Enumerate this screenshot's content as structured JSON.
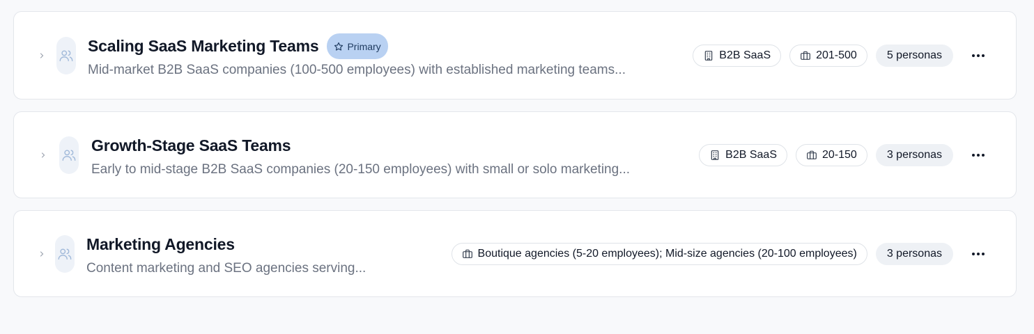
{
  "segments": [
    {
      "title": "Scaling SaaS Marketing Teams",
      "badge": "Primary",
      "description": "Mid-market B2B SaaS companies (100-500 employees) with established marketing teams...",
      "industry": "B2B SaaS",
      "size": "201-500",
      "personas": "5 personas"
    },
    {
      "title": "Growth-Stage SaaS Teams",
      "description": "Early to mid-stage B2B SaaS companies (20-150 employees) with small or solo marketing...",
      "industry": "B2B SaaS",
      "size": "20-150",
      "personas": "3 personas"
    },
    {
      "title": "Marketing Agencies",
      "description": "Content marketing and SEO agencies serving...",
      "size": "Boutique agencies (5-20 employees); Mid-size agencies (20-100 employees)",
      "personas": "3 personas"
    }
  ],
  "icons": {
    "expand": "chevron-right-icon",
    "avatar": "users-icon",
    "badge": "star-icon",
    "industry": "building-icon",
    "size": "briefcase-icon",
    "menu": "more-horizontal-icon"
  },
  "colors": {
    "primary_badge_bg": "#b9d1f2",
    "persona_chip_bg": "#eef1f5",
    "card_border": "#e3e6eb"
  }
}
